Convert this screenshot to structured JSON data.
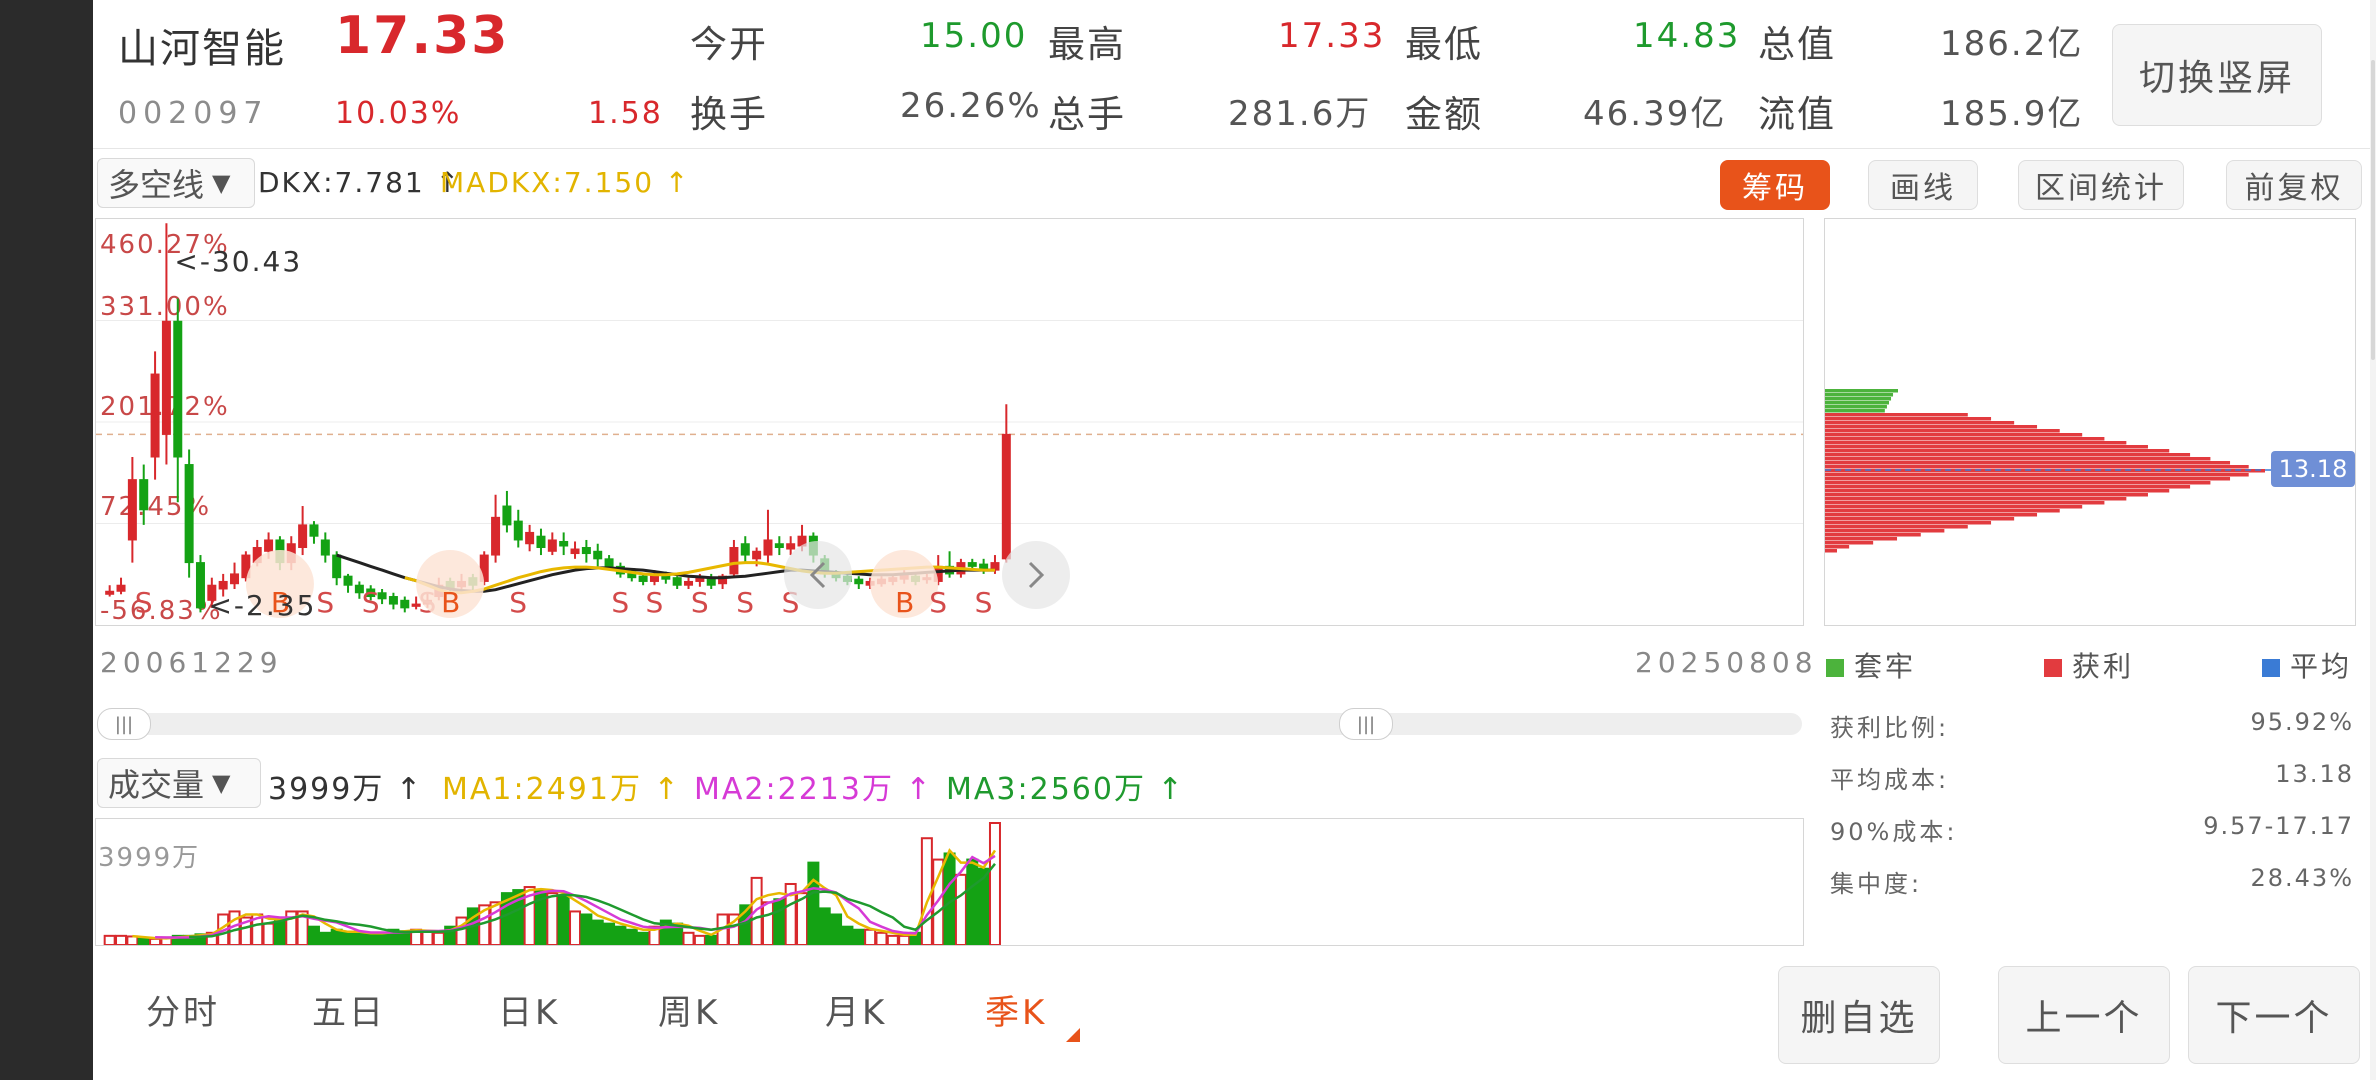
{
  "quote": {
    "name": "山河智能",
    "price": "17.33",
    "code": "002097",
    "change_pct": "10.03%",
    "change": "1.58",
    "open_label": "今开",
    "open": "15.00",
    "high_label": "最高",
    "high": "17.33",
    "low_label": "最低",
    "low": "14.83",
    "mcap_label": "总值",
    "mcap": "186.2亿",
    "turnover_label": "换手",
    "turnover": "26.26%",
    "vol_label": "总手",
    "vol": "281.6万",
    "amount_label": "金额",
    "amount": "46.39亿",
    "float_label": "流值",
    "float_mcap": "185.9亿",
    "switch_button": "切换竖屏"
  },
  "indicator": {
    "select": "多空线",
    "dkx": "DKX:7.781 ↑",
    "madkx": "MADKX:7.150 ↑"
  },
  "toolbar": {
    "chips": "筹码",
    "draw": "画线",
    "range_stats": "区间统计",
    "adjust": "前复权"
  },
  "colors": {
    "up": "#d8282c",
    "down": "#14a214",
    "dkx": "#222222",
    "madkx": "#e8b800",
    "accent": "#e8531a"
  },
  "kline": {
    "y_labels": [
      "460.27%",
      "331.00%",
      "201.72%",
      "72.45%",
      "-56.83%"
    ],
    "max_marker": "<-30.43",
    "min_marker": "<-2.35",
    "date_start": "20061229",
    "date_end": "20250808",
    "signal_s": "S",
    "signal_b": "B"
  },
  "volume": {
    "select": "成交量",
    "vol": "3999万 ↑",
    "ma1": "MA1:2491万 ↑",
    "ma2": "MA2:2213万 ↑",
    "ma3": "MA3:2560万 ↑",
    "y_label": "3999万"
  },
  "chips_panel": {
    "avg_label_value": "13.18",
    "legend": [
      "套牢",
      "获利",
      "平均"
    ],
    "legend_colors": [
      "#4cb33c",
      "#e23b3f",
      "#3a7bd5"
    ],
    "stats": [
      {
        "label": "获利比例:",
        "value": "95.92%"
      },
      {
        "label": "平均成本:",
        "value": "13.18"
      },
      {
        "label": "90%成本:",
        "value": "9.57-17.17"
      },
      {
        "label": "集中度:",
        "value": "28.43%"
      }
    ]
  },
  "tabs": [
    "分时",
    "五日",
    "日K",
    "周K",
    "月K",
    "季K"
  ],
  "active_tab": "季K",
  "bottom_buttons": {
    "remove": "删自选",
    "prev": "上一个",
    "next": "下一个"
  },
  "chart_data": {
    "type": "candlestick",
    "period": "quarterly",
    "y_unit": "%",
    "ylim": [
      -56.83,
      460.27
    ],
    "candles": [
      [
        -28,
        -32,
        -20,
        -35
      ],
      [
        -20,
        -28,
        -10,
        -32
      ],
      [
        120,
        40,
        150,
        10
      ],
      [
        80,
        120,
        140,
        60
      ],
      [
        260,
        150,
        290,
        120
      ],
      [
        330,
        180,
        460,
        140
      ],
      [
        150,
        330,
        360,
        90
      ],
      [
        10,
        140,
        160,
        -10
      ],
      [
        -50,
        10,
        20,
        -56
      ],
      [
        -20,
        -40,
        -10,
        -50
      ],
      [
        -15,
        -25,
        -5,
        -35
      ],
      [
        -5,
        -18,
        10,
        -25
      ],
      [
        20,
        -10,
        25,
        -15
      ],
      [
        30,
        10,
        40,
        5
      ],
      [
        40,
        25,
        50,
        15
      ],
      [
        10,
        40,
        45,
        0
      ],
      [
        35,
        10,
        45,
        0
      ],
      [
        60,
        30,
        85,
        20
      ],
      [
        45,
        60,
        65,
        35
      ],
      [
        20,
        40,
        50,
        10
      ],
      [
        -10,
        20,
        25,
        -20
      ],
      [
        -20,
        -8,
        -5,
        -30
      ],
      [
        -30,
        -20,
        -15,
        -38
      ],
      [
        -35,
        -25,
        -20,
        -40
      ],
      [
        -38,
        -30,
        -25,
        -45
      ],
      [
        -45,
        -35,
        -30,
        -52
      ],
      [
        -50,
        -40,
        -35,
        -56
      ],
      [
        -45,
        -48,
        -35,
        -52
      ],
      [
        -40,
        -45,
        -30,
        -50
      ],
      [
        -20,
        -35,
        -10,
        -40
      ],
      [
        -25,
        -15,
        -10,
        -30
      ],
      [
        -15,
        -22,
        -5,
        -28
      ],
      [
        -20,
        -10,
        -5,
        -28
      ],
      [
        20,
        -15,
        25,
        -20
      ],
      [
        70,
        20,
        100,
        10
      ],
      [
        60,
        85,
        105,
        50
      ],
      [
        40,
        65,
        80,
        30
      ],
      [
        50,
        35,
        60,
        25
      ],
      [
        30,
        45,
        55,
        20
      ],
      [
        40,
        25,
        50,
        20
      ],
      [
        32,
        38,
        50,
        20
      ],
      [
        28,
        22,
        38,
        15
      ],
      [
        22,
        30,
        40,
        10
      ],
      [
        15,
        25,
        35,
        5
      ],
      [
        5,
        15,
        20,
        0
      ],
      [
        -5,
        5,
        10,
        -10
      ],
      [
        -10,
        -2,
        0,
        -15
      ],
      [
        -15,
        -8,
        -5,
        -20
      ],
      [
        -5,
        -15,
        0,
        -20
      ],
      [
        -12,
        -5,
        -2,
        -18
      ],
      [
        -20,
        -10,
        -8,
        -25
      ],
      [
        -15,
        -20,
        -10,
        -25
      ],
      [
        -10,
        -15,
        -5,
        -22
      ],
      [
        -20,
        -10,
        -5,
        -25
      ],
      [
        -8,
        -18,
        -5,
        -25
      ],
      [
        30,
        -5,
        40,
        -10
      ],
      [
        20,
        35,
        45,
        10
      ],
      [
        25,
        15,
        30,
        5
      ],
      [
        40,
        20,
        80,
        10
      ],
      [
        30,
        35,
        45,
        20
      ],
      [
        35,
        28,
        45,
        20
      ],
      [
        45,
        32,
        60,
        25
      ],
      [
        20,
        45,
        50,
        10
      ],
      [
        -5,
        15,
        20,
        -10
      ],
      [
        -10,
        -5,
        0,
        -15
      ],
      [
        -15,
        -8,
        -5,
        -20
      ],
      [
        -18,
        -12,
        -8,
        -25
      ],
      [
        -15,
        -20,
        -10,
        -25
      ],
      [
        -12,
        -18,
        -8,
        -22
      ],
      [
        -10,
        -15,
        -5,
        -20
      ],
      [
        -5,
        -12,
        0,
        -18
      ],
      [
        -15,
        -8,
        -5,
        -20
      ],
      [
        -10,
        -12,
        -5,
        -18
      ],
      [
        5,
        -15,
        20,
        -20
      ],
      [
        -5,
        5,
        25,
        -10
      ],
      [
        10,
        -5,
        15,
        -10
      ],
      [
        5,
        10,
        15,
        0
      ],
      [
        0,
        8,
        15,
        -5
      ],
      [
        10,
        0,
        20,
        -5
      ],
      [
        180,
        15,
        220,
        10
      ]
    ],
    "signals": [
      {
        "index": 3,
        "type": "S"
      },
      {
        "index": 15,
        "type": "B"
      },
      {
        "index": 19,
        "type": "S"
      },
      {
        "index": 23,
        "type": "S"
      },
      {
        "index": 28,
        "type": "S"
      },
      {
        "index": 30,
        "type": "B"
      },
      {
        "index": 36,
        "type": "S"
      },
      {
        "index": 45,
        "type": "S"
      },
      {
        "index": 48,
        "type": "S"
      },
      {
        "index": 52,
        "type": "S"
      },
      {
        "index": 56,
        "type": "S"
      },
      {
        "index": 60,
        "type": "S"
      },
      {
        "index": 70,
        "type": "B"
      },
      {
        "index": 73,
        "type": "S"
      },
      {
        "index": 77,
        "type": "S"
      }
    ],
    "dkx_line": [
      null,
      null,
      null,
      null,
      null,
      null,
      null,
      null,
      null,
      null,
      null,
      null,
      null,
      null,
      null,
      null,
      null,
      null,
      null,
      null,
      20,
      15,
      10,
      5,
      0,
      -5,
      -10,
      -14,
      -18,
      -22,
      -25,
      -27,
      -28,
      -28,
      -26,
      -22,
      -18,
      -14,
      -10,
      -6,
      -3,
      0,
      2,
      3,
      3,
      2,
      1,
      0,
      -2,
      -4,
      -6,
      -8,
      -9,
      -10,
      -10,
      -9,
      -8,
      -6,
      -4,
      -2,
      0,
      0,
      -1,
      -2,
      -3,
      -4,
      -5,
      -6,
      -6,
      -6,
      -5,
      -4,
      -3,
      -2,
      -1,
      0,
      0,
      0,
      0
    ],
    "madkx_line": [
      null,
      null,
      null,
      null,
      null,
      null,
      null,
      null,
      null,
      null,
      null,
      null,
      null,
      null,
      null,
      null,
      null,
      null,
      null,
      null,
      null,
      null,
      null,
      null,
      null,
      null,
      -10,
      -14,
      -20,
      -26,
      -30,
      -30,
      -28,
      -25,
      -20,
      -15,
      -10,
      -6,
      -2,
      1,
      3,
      4,
      4,
      3,
      1,
      -1,
      -3,
      -5,
      -6,
      -6,
      -5,
      -3,
      0,
      3,
      6,
      9,
      10,
      10,
      8,
      5,
      2,
      -1,
      -3,
      -4,
      -4,
      -3,
      -2,
      -1,
      0,
      1,
      2,
      3,
      4,
      4,
      3,
      2,
      1,
      0,
      0
    ],
    "volume": {
      "unit": "万",
      "ylim": [
        0,
        3999
      ],
      "values": [
        300,
        300,
        280,
        200,
        200,
        250,
        300,
        300,
        350,
        400,
        1000,
        1100,
        900,
        1000,
        700,
        800,
        1100,
        1100,
        600,
        400,
        500,
        400,
        400,
        350,
        400,
        500,
        450,
        500,
        450,
        400,
        600,
        900,
        1200,
        1300,
        1400,
        1700,
        1800,
        1900,
        1800,
        1700,
        1600,
        1100,
        1000,
        800,
        700,
        600,
        500,
        400,
        600,
        800,
        700,
        400,
        300,
        300,
        1000,
        1000,
        1300,
        2200,
        1400,
        1500,
        2000,
        1700,
        2700,
        1200,
        1000,
        600,
        500,
        500,
        400,
        300,
        300,
        400,
        3500,
        2800,
        3000,
        2300,
        2800,
        2500,
        3999
      ]
    }
  }
}
